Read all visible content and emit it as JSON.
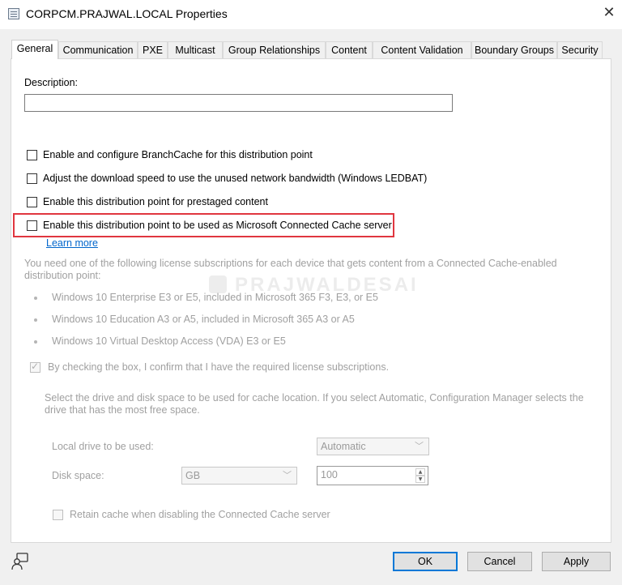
{
  "window": {
    "title": "CORPCM.PRAJWAL.LOCAL Properties",
    "close_glyph": "✕"
  },
  "tabs": [
    {
      "label": "General",
      "active": true
    },
    {
      "label": "Communication"
    },
    {
      "label": "PXE"
    },
    {
      "label": "Multicast"
    },
    {
      "label": "Group Relationships"
    },
    {
      "label": "Content"
    },
    {
      "label": "Content Validation"
    },
    {
      "label": "Boundary Groups"
    },
    {
      "label": "Security"
    }
  ],
  "general": {
    "description_label": "Description:",
    "description_value": "",
    "options": [
      {
        "label": "Enable and configure BranchCache for this distribution point",
        "checked": false
      },
      {
        "label": "Adjust the download speed to use the unused network bandwidth (Windows LEDBAT)",
        "checked": false
      },
      {
        "label": "Enable this distribution point for prestaged content",
        "checked": false
      },
      {
        "label": "Enable this distribution point to be used as Microsoft Connected Cache server",
        "checked": false
      }
    ],
    "learn_more": "Learn more",
    "license_text_line1": "You need one of the following license subscriptions for each device that gets content from a Connected Cache-enabled",
    "license_text_line2": "distribution point:",
    "licenses": [
      "Windows 10 Enterprise E3 or E5, included in Microsoft 365 F3, E3, or E5",
      "Windows 10 Education A3 or A5, included in Microsoft 365 A3 or A5",
      "Windows 10 Virtual Desktop Access (VDA) E3 or E5"
    ],
    "confirm_label": "By checking the box, I confirm that I have the required license subscriptions.",
    "confirm_checked": true,
    "drive_text_line1": "Select the drive and disk space to be used for cache location. If you select Automatic, Configuration Manager selects the",
    "drive_text_line2": "drive that has the most free space.",
    "local_drive_label": "Local drive to be used:",
    "local_drive_value": "Automatic",
    "disk_space_label": "Disk space:",
    "disk_space_unit": "GB",
    "disk_space_value": "100",
    "retain_label": "Retain cache when disabling the Connected Cache server",
    "retain_checked": false
  },
  "watermark": "PRAJWALDESAI",
  "buttons": {
    "ok": "OK",
    "cancel": "Cancel",
    "apply": "Apply"
  },
  "icons": {
    "app": "properties-window-icon",
    "help": "help-person-icon"
  },
  "colors": {
    "highlight_border": "#e0363f",
    "link": "#0066cc",
    "default_button_border": "#0078d7"
  }
}
